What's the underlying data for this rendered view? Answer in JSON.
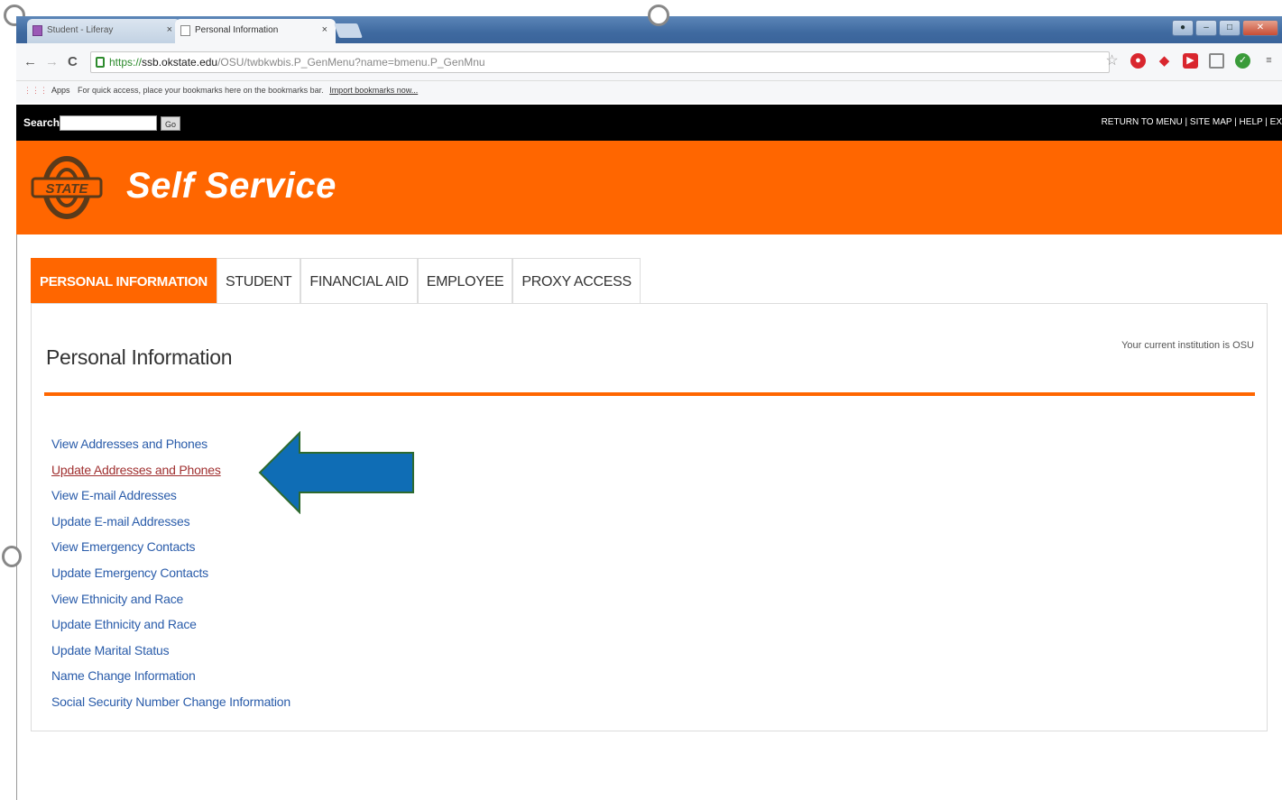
{
  "browser": {
    "tabs": [
      {
        "label": "Student - Liferay",
        "active": false
      },
      {
        "label": "Personal Information",
        "active": true
      }
    ],
    "tab_close": "×",
    "url": {
      "scheme": "https://",
      "host": "ssb.okstate.edu",
      "path": "/OSU/twbkwbis.P_GenMenu?name=bmenu.P_GenMnu"
    },
    "bookmarks_bar": {
      "apps_label": "Apps",
      "hint": "For quick access, place your bookmarks here on the bookmarks bar.",
      "import_link": "Import bookmarks now..."
    }
  },
  "site_header": {
    "search_label": "Search",
    "go_label": "Go",
    "top_links": "RETURN TO MENU | SITE MAP | HELP | EX",
    "title": "Self Service",
    "logo_text": "STATE"
  },
  "nav_tabs": [
    {
      "label": "PERSONAL INFORMATION",
      "active": true
    },
    {
      "label": "STUDENT",
      "active": false
    },
    {
      "label": "FINANCIAL AID",
      "active": false
    },
    {
      "label": "EMPLOYEE",
      "active": false
    },
    {
      "label": "PROXY ACCESS",
      "active": false
    }
  ],
  "panel": {
    "title": "Personal Information",
    "institution_note": "Your current institution is OSU",
    "links": [
      {
        "label": "View Addresses and Phones",
        "visited": false
      },
      {
        "label": "Update Addresses and Phones",
        "visited": true
      },
      {
        "label": "View E-mail Addresses",
        "visited": false
      },
      {
        "label": "Update E-mail Addresses",
        "visited": false
      },
      {
        "label": "View Emergency Contacts",
        "visited": false
      },
      {
        "label": "Update Emergency Contacts",
        "visited": false
      },
      {
        "label": "View Ethnicity and Race",
        "visited": false
      },
      {
        "label": "Update Ethnicity and Race",
        "visited": false
      },
      {
        "label": "Update Marital Status",
        "visited": false
      },
      {
        "label": "Name Change Information",
        "visited": false
      },
      {
        "label": "Social Security Number Change Information",
        "visited": false
      }
    ]
  },
  "colors": {
    "brand_orange": "#ff6600",
    "link_blue": "#2a5caa",
    "visited_red": "#a03030",
    "annotation_arrow": "#0f6db5"
  }
}
